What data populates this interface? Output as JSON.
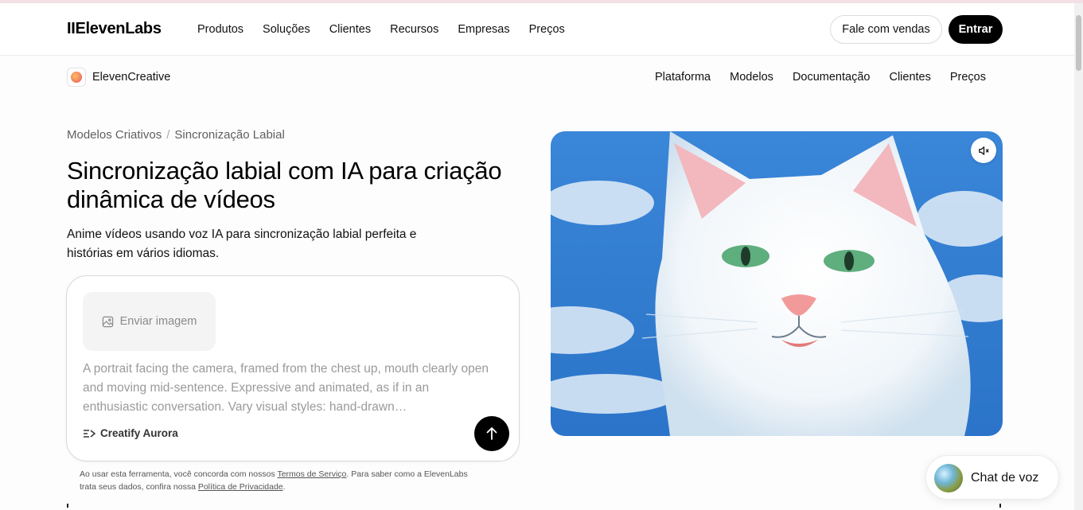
{
  "top_nav": {
    "logo": "IIElevenLabs",
    "links": [
      "Produtos",
      "Soluções",
      "Clientes",
      "Recursos",
      "Empresas",
      "Preços"
    ],
    "contact_sales_label": "Fale com vendas",
    "login_label": "Entrar"
  },
  "sub_nav": {
    "brand_name": "ElevenCreative",
    "links": [
      "Plataforma",
      "Modelos",
      "Documentação",
      "Clientes",
      "Preços"
    ]
  },
  "breadcrumb": {
    "items": [
      "Modelos Criativos",
      "Sincronização Labial"
    ],
    "separator": "/"
  },
  "hero": {
    "title": "Sincronização labial com IA para criação dinâmica de vídeos",
    "subtitle": "Anime vídeos usando voz IA para sincronização labial perfeita e histórias em vários idiomas."
  },
  "prompt": {
    "upload_label": "Enviar imagem",
    "prompt_text": "A portrait facing the camera, framed from the chest up, mouth clearly open and moving mid-sentence. Expressive and animated, as if in an enthusiastic conversation. Vary visual styles: hand-drawn…",
    "model_label": "Creatify Aurora"
  },
  "legal": {
    "part1": "Ao usar esta ferramenta, você concorda com nossos ",
    "terms_link": "Termos de Serviço",
    "part2": ". Para saber como a ElevenLabs trata seus dados, confira nossa ",
    "privacy_link": "Política de Privacidade",
    "part3": "."
  },
  "media": {
    "icon": "speaker-muted-icon"
  },
  "chat_widget": {
    "label": "Chat de voz"
  },
  "colors": {
    "accent": "#000000",
    "sky": "#2f7fd6",
    "cat_white": "#f4f8fb",
    "cat_eye": "#5fae7e",
    "nose": "#f29a9a"
  }
}
